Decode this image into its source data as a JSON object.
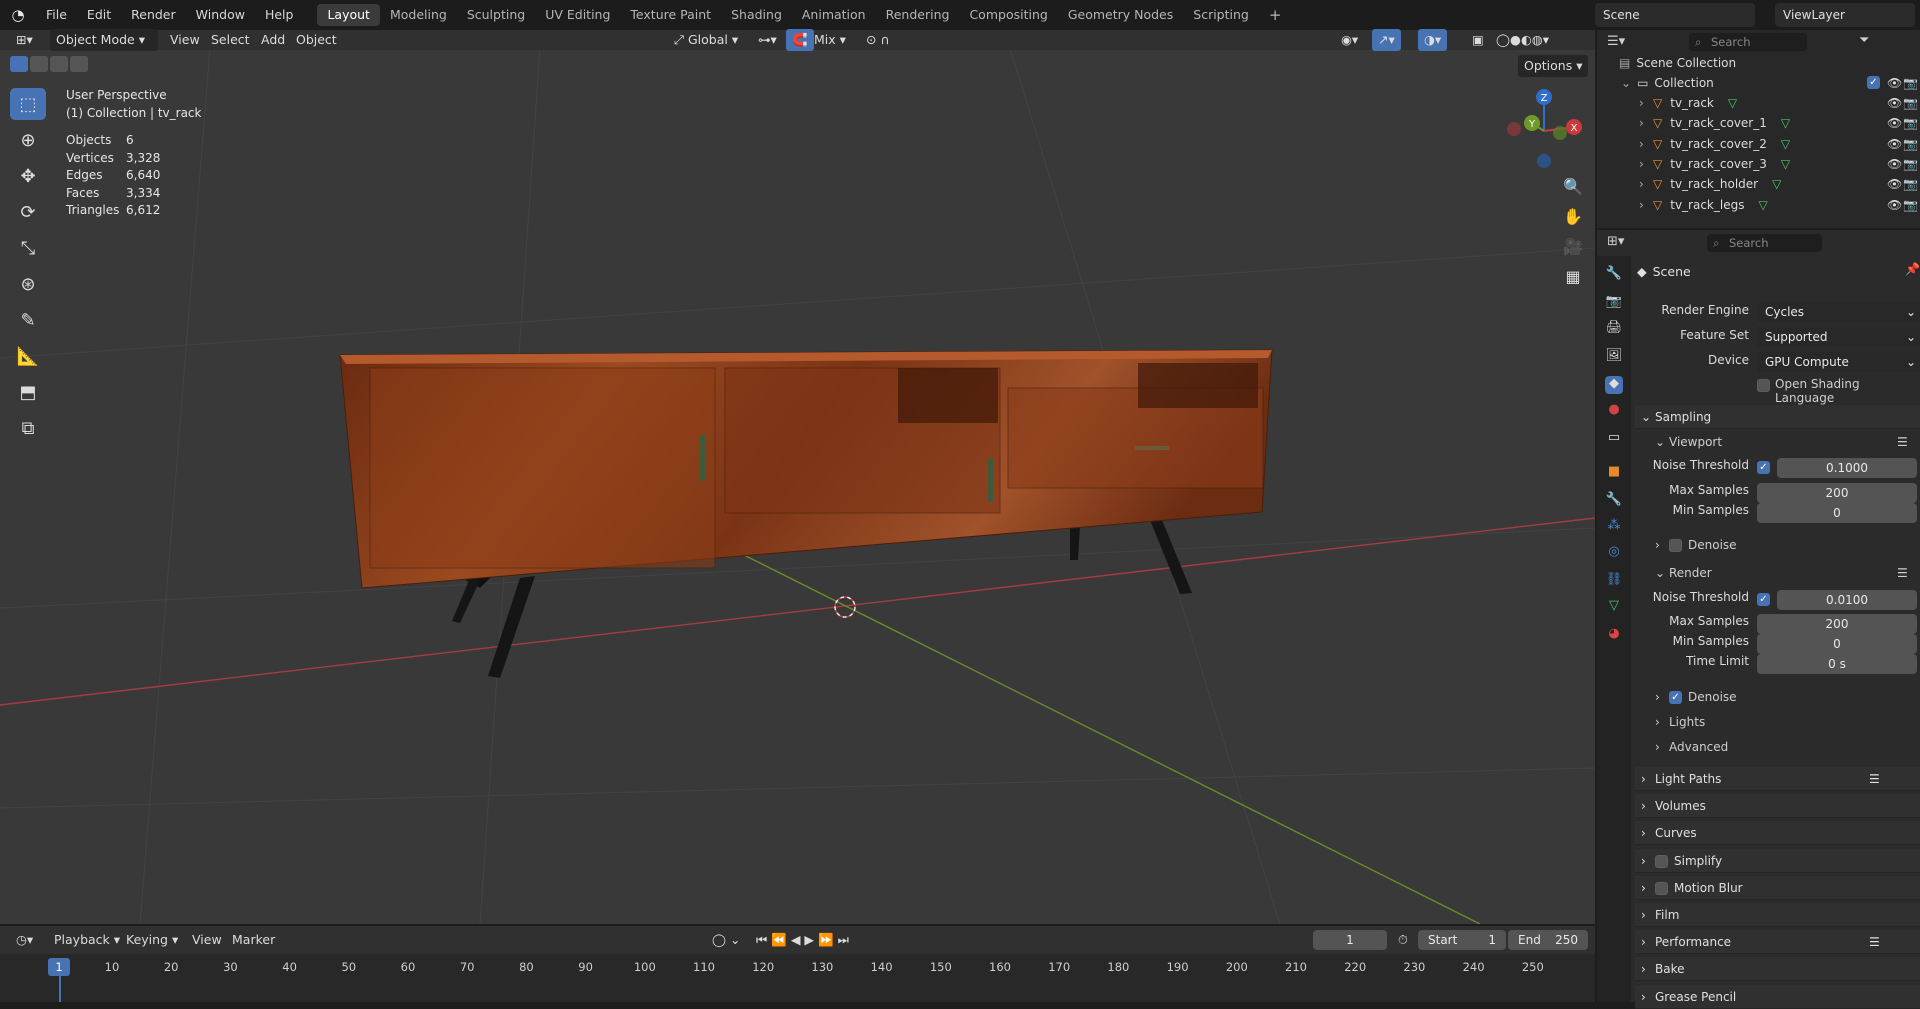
{
  "menu": [
    "File",
    "Edit",
    "Render",
    "Window",
    "Help"
  ],
  "workspaces": [
    "Layout",
    "Modeling",
    "Sculpting",
    "UV Editing",
    "Texture Paint",
    "Shading",
    "Animation",
    "Rendering",
    "Compositing",
    "Geometry Nodes",
    "Scripting"
  ],
  "active_workspace": "Layout",
  "scene_name": "Scene",
  "view_layer": "ViewLayer",
  "viewport_header": {
    "mode": "Object Mode",
    "view": "View",
    "select": "Select",
    "add": "Add",
    "object": "Object",
    "orientation": "Global",
    "snap_mix": "Mix",
    "options": "Options"
  },
  "overlay": {
    "title": "User Perspective",
    "subtitle": "(1) Collection | tv_rack"
  },
  "stats": [
    {
      "k": "Objects",
      "v": "6"
    },
    {
      "k": "Vertices",
      "v": "3,328"
    },
    {
      "k": "Edges",
      "v": "6,640"
    },
    {
      "k": "Faces",
      "v": "3,334"
    },
    {
      "k": "Triangles",
      "v": "6,612"
    }
  ],
  "gizmo": {
    "z": "Z",
    "y": "Y",
    "x": "X"
  },
  "outliner": {
    "search_placeholder": "Search",
    "scene_collection": "Scene Collection",
    "collection": "Collection",
    "items": [
      "tv_rack",
      "tv_rack_cover_1",
      "tv_rack_cover_2",
      "tv_rack_cover_3",
      "tv_rack_holder",
      "tv_rack_legs"
    ]
  },
  "properties": {
    "search_placeholder": "Search",
    "context": "Scene",
    "render_engine_label": "Render Engine",
    "render_engine": "Cycles",
    "feature_set_label": "Feature Set",
    "feature_set": "Supported",
    "device_label": "Device",
    "device": "GPU Compute",
    "osl_label": "Open Shading Language",
    "sampling": "Sampling",
    "viewport": "Viewport",
    "noise_threshold_label": "Noise Threshold",
    "vp_noise_threshold": "0.1000",
    "max_samples_label": "Max Samples",
    "vp_max_samples": "200",
    "min_samples_label": "Min Samples",
    "vp_min_samples": "0",
    "denoise_label": "Denoise",
    "render": "Render",
    "r_noise_threshold": "0.0100",
    "r_max_samples": "200",
    "r_min_samples": "0",
    "time_limit_label": "Time Limit",
    "r_time_limit": "0 s",
    "lights": "Lights",
    "advanced": "Advanced",
    "panels": [
      "Light Paths",
      "Volumes",
      "Curves",
      "Simplify",
      "Motion Blur",
      "Film",
      "Performance",
      "Bake",
      "Grease Pencil"
    ]
  },
  "timeline": {
    "playback": "Playback",
    "keying": "Keying",
    "view": "View",
    "marker": "Marker",
    "current_frame": "1",
    "start_label": "Start",
    "start": "1",
    "end_label": "End",
    "end": "250",
    "ticks": [
      "10",
      "20",
      "30",
      "40",
      "50",
      "60",
      "70",
      "80",
      "90",
      "100",
      "110",
      "120",
      "130",
      "140",
      "150",
      "160",
      "170",
      "180",
      "190",
      "200",
      "210",
      "220",
      "230",
      "240",
      "250"
    ],
    "playhead": "1"
  },
  "colors": {
    "accent": "#4772b3",
    "x_axis": "#a53b45",
    "y_axis": "#6b8a2a",
    "wood": "#8a3f1c"
  }
}
